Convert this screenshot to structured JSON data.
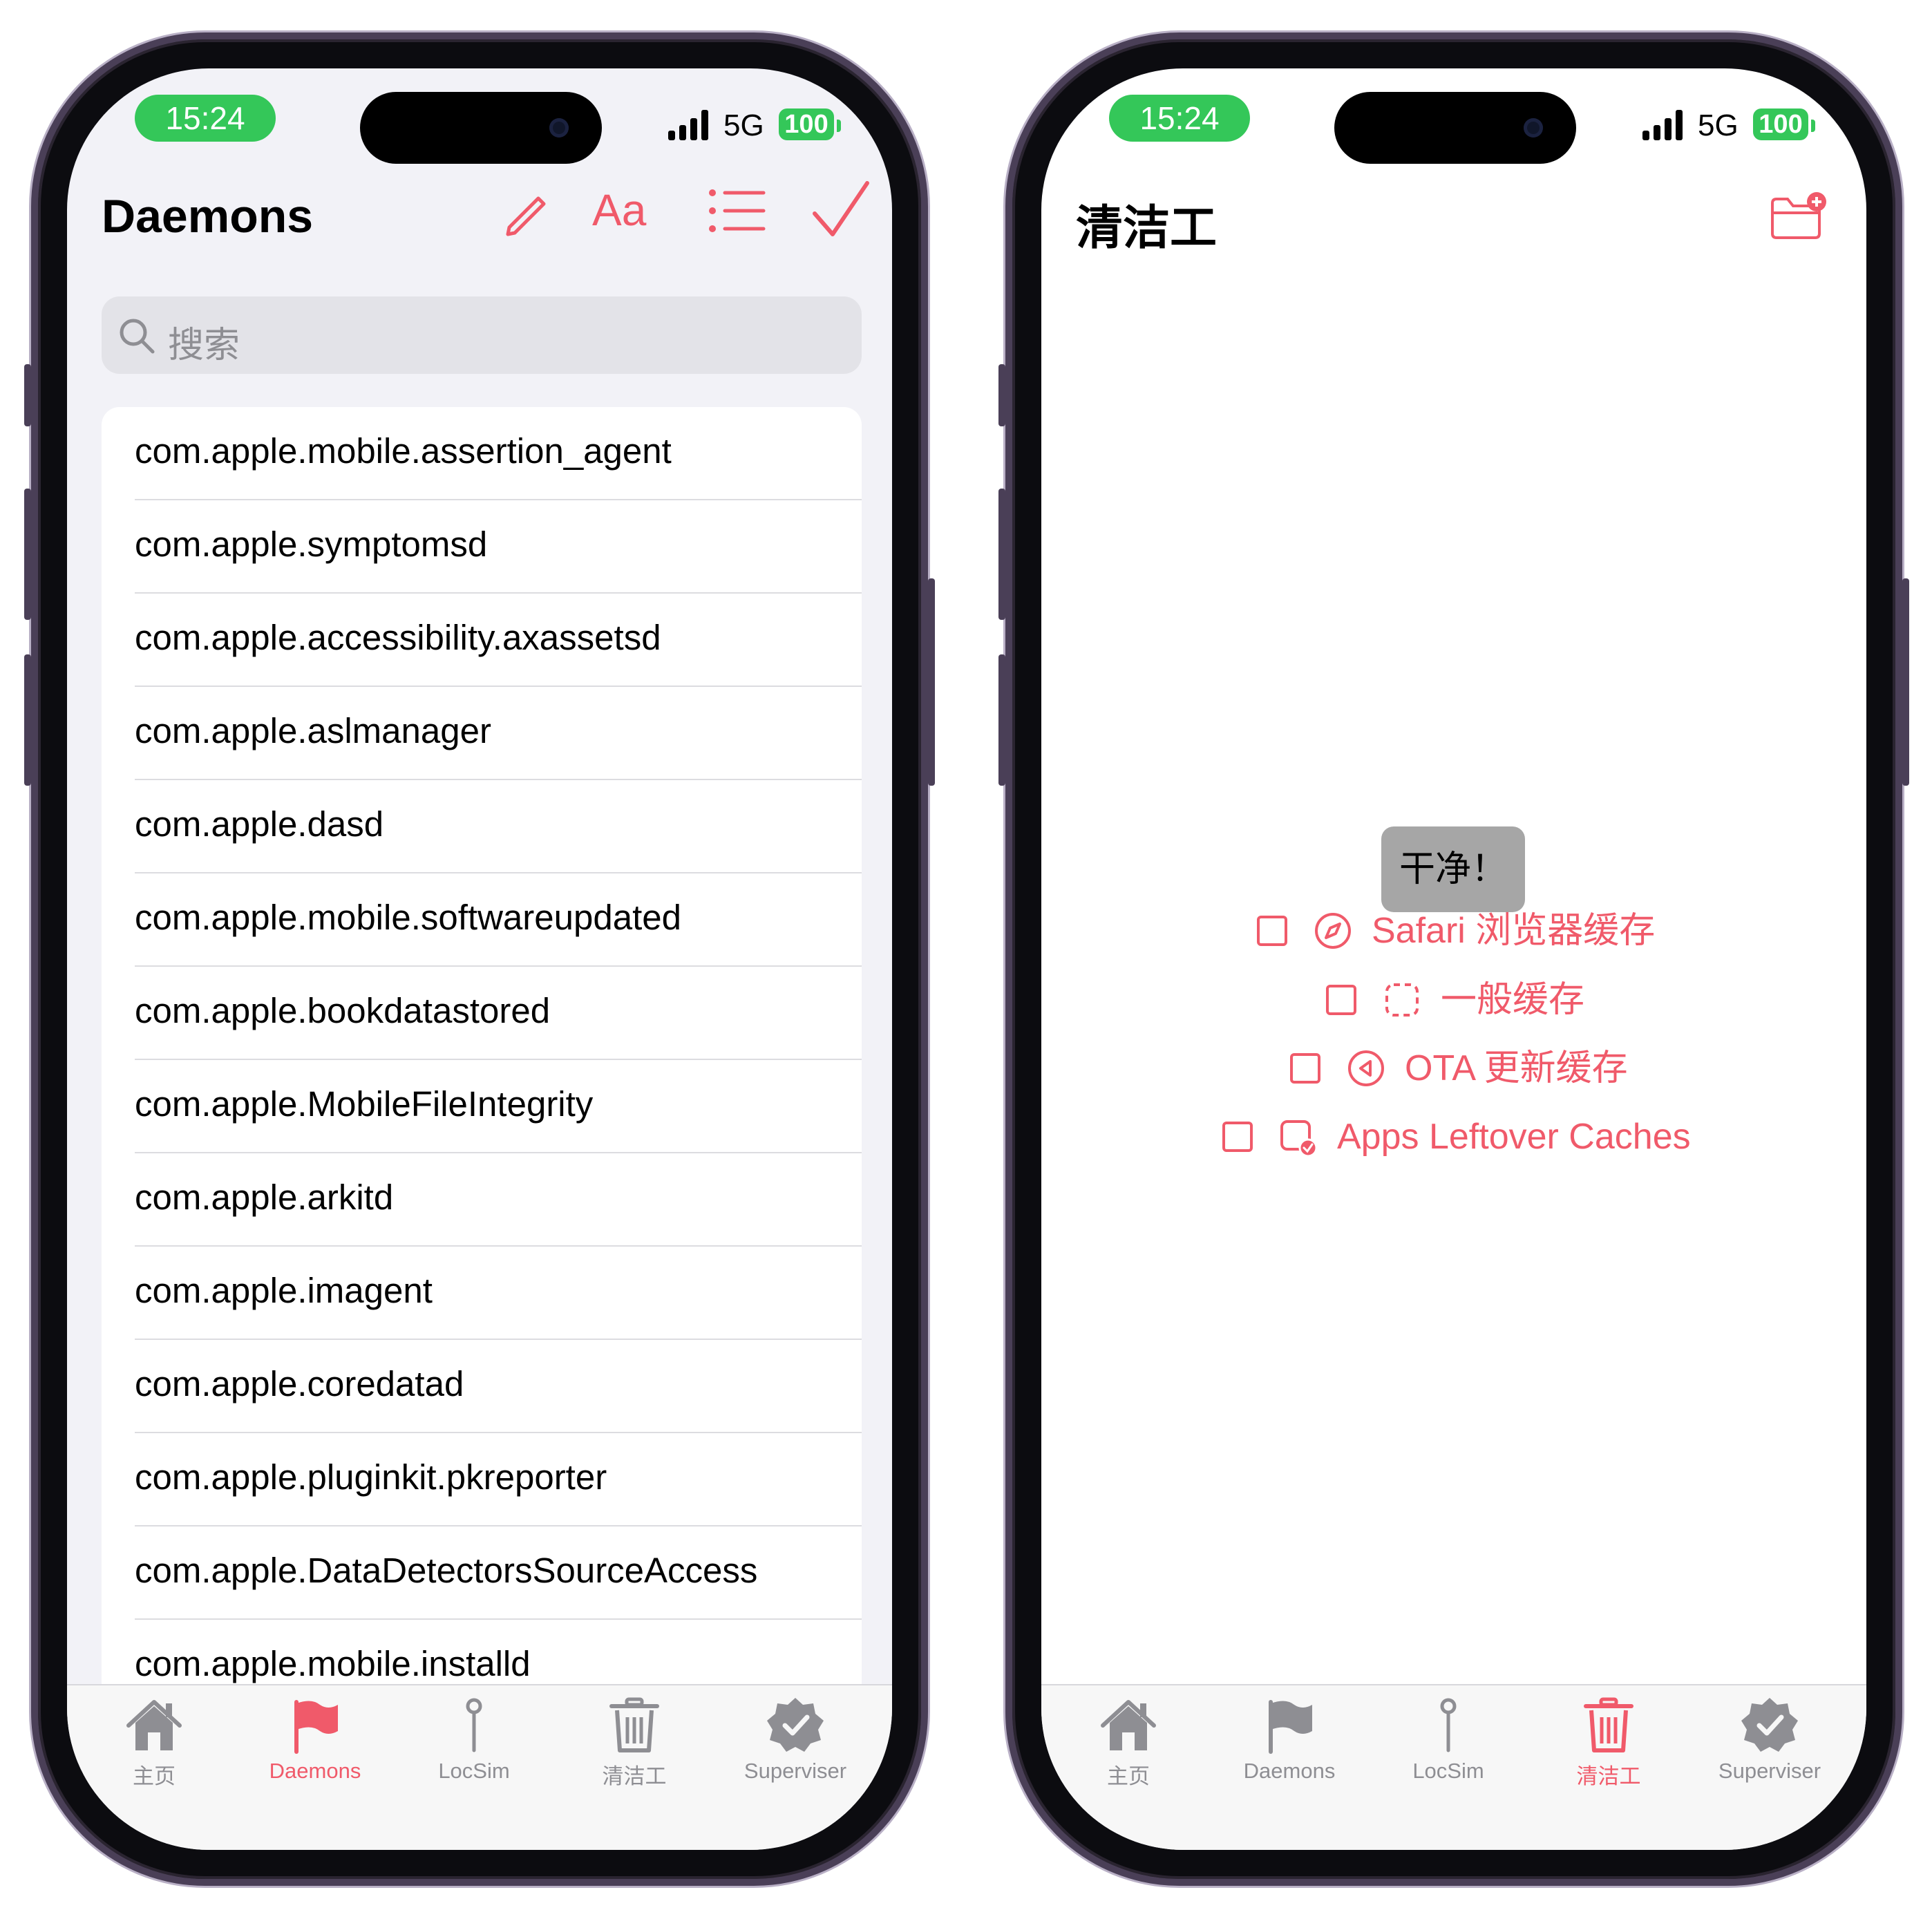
{
  "status_bar": {
    "time": "15:24",
    "network": "5G",
    "battery": "100"
  },
  "left_screen": {
    "title": "Daemons",
    "toolbar": {
      "edit_icon": "pencil-icon",
      "font_label": "Aa",
      "list_icon": "list-icon",
      "done_icon": "checkmark-icon"
    },
    "search": {
      "placeholder": "搜索"
    },
    "daemons": [
      "com.apple.mobile.assertion_agent",
      "com.apple.symptomsd",
      "com.apple.accessibility.axassetsd",
      "com.apple.aslmanager",
      "com.apple.dasd",
      "com.apple.mobile.softwareupdated",
      "com.apple.bookdatastored",
      "com.apple.MobileFileIntegrity",
      "com.apple.arkitd",
      "com.apple.imagent",
      "com.apple.coredatad",
      "com.apple.pluginkit.pkreporter",
      "com.apple.DataDetectorsSourceAccess",
      "com.apple.mobile.installd"
    ]
  },
  "right_screen": {
    "title": "清洁工",
    "clean_button": "干净！",
    "options": [
      {
        "label": "Safari 浏览器缓存",
        "icon": "compass-icon",
        "checked": false
      },
      {
        "label": "一般缓存",
        "icon": "dashed-square-icon",
        "checked": false
      },
      {
        "label": "OTA 更新缓存",
        "icon": "rewind-circle-icon",
        "checked": false
      },
      {
        "label": "Apps Leftover Caches",
        "icon": "app-badge-check-icon",
        "checked": false
      }
    ]
  },
  "tabs": [
    {
      "label": "主页",
      "icon": "house-icon"
    },
    {
      "label": "Daemons",
      "icon": "flag-icon"
    },
    {
      "label": "LocSim",
      "icon": "pin-icon"
    },
    {
      "label": "清洁工",
      "icon": "trash-icon"
    },
    {
      "label": "Superviser",
      "icon": "checkmark-seal-icon"
    }
  ],
  "colors": {
    "accent": "#f05a6a",
    "status_green": "#34c759",
    "tab_inactive": "#8e8e93",
    "button_gray": "#a6a6a6"
  }
}
